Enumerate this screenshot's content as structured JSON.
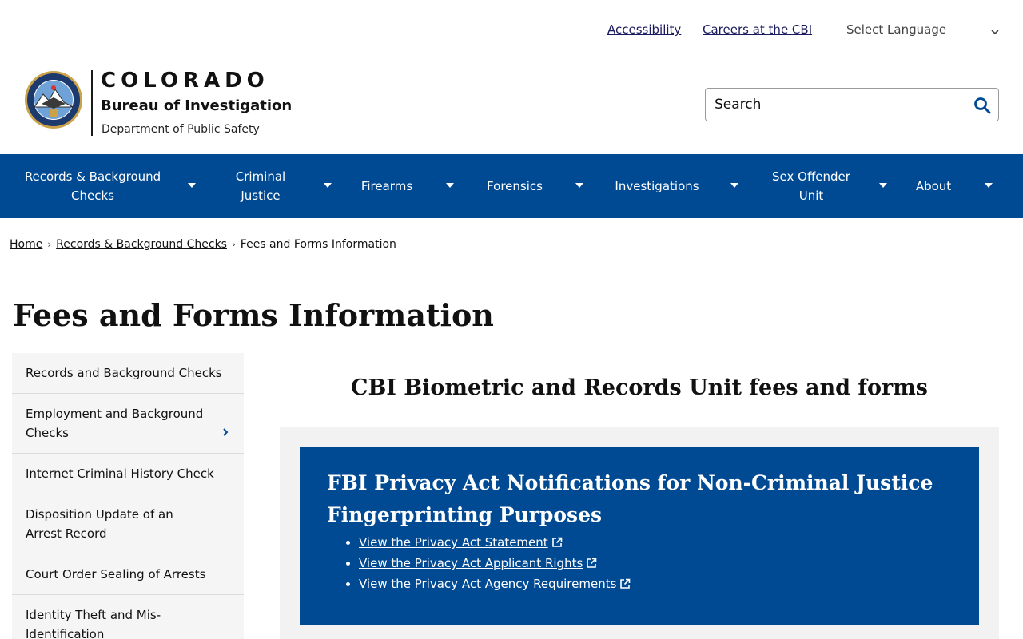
{
  "utility": {
    "accessibility": "Accessibility",
    "careers": "Careers at the CBI",
    "language": "Select Language"
  },
  "logo": {
    "colorado": "COLORADO",
    "bureau": "Bureau of Investigation",
    "department": "Department of Public Safety"
  },
  "search": {
    "placeholder": "Search"
  },
  "nav": {
    "items": [
      {
        "label": "Records & Background Checks"
      },
      {
        "label": "Criminal Justice"
      },
      {
        "label": "Firearms"
      },
      {
        "label": "Forensics"
      },
      {
        "label": "Investigations"
      },
      {
        "label": "Sex Offender Unit"
      },
      {
        "label": "About"
      }
    ]
  },
  "breadcrumb": {
    "home": "Home",
    "parent": "Records & Background Checks",
    "current": "Fees and Forms Information",
    "separator": "›"
  },
  "page": {
    "title": "Fees and Forms Information"
  },
  "sidebar": {
    "items": [
      {
        "label": "Records and Background Checks"
      },
      {
        "label": "Employment and Background Checks"
      },
      {
        "label": "Internet Criminal History Check"
      },
      {
        "label": "Disposition Update of an Arrest Record"
      },
      {
        "label": "Court Order Sealing of Arrests"
      },
      {
        "label": "Identity Theft and Mis-Identification"
      }
    ]
  },
  "main": {
    "section_title": "CBI Biometric and Records Unit fees and forms",
    "notice": {
      "title": "FBI Privacy Act Notifications for Non-Criminal Justice Fingerprinting Purposes",
      "links": [
        {
          "label": "View the Privacy Act Statement"
        },
        {
          "label": "View the Privacy Act Applicant Rights"
        },
        {
          "label": "View the Privacy Act Agency Requirements"
        }
      ]
    }
  },
  "colors": {
    "brand_blue": "#004a93",
    "link_navy": "#1a1a5e",
    "sidebar_bg": "#f5f5f5"
  },
  "icons": {
    "search": "search-icon",
    "language_chevron": "chevron-down-icon",
    "external": "external-link-icon",
    "seal": "cbi-seal-logo"
  }
}
